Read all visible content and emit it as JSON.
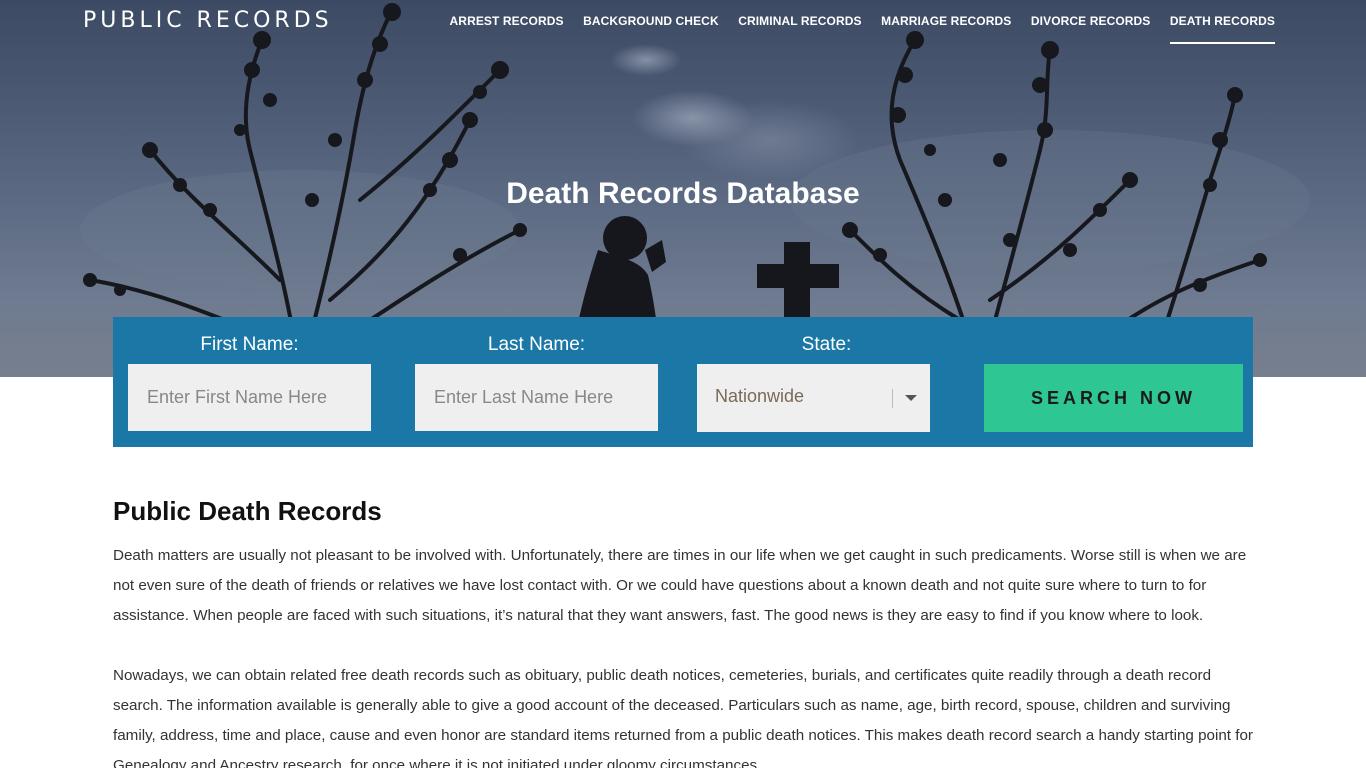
{
  "header": {
    "logo": "PUBLIC RECORDS",
    "nav": [
      {
        "label": "ARREST RECORDS",
        "active": false
      },
      {
        "label": "BACKGROUND CHECK",
        "active": false
      },
      {
        "label": "CRIMINAL RECORDS",
        "active": false
      },
      {
        "label": "MARRIAGE RECORDS",
        "active": false
      },
      {
        "label": "DIVORCE RECORDS",
        "active": false
      },
      {
        "label": "DEATH RECORDS",
        "active": true
      }
    ]
  },
  "hero": {
    "title": "Death Records Database"
  },
  "search": {
    "first_name_label": "First Name:",
    "first_name_placeholder": "Enter First Name Here",
    "last_name_label": "Last Name:",
    "last_name_placeholder": "Enter Last Name Here",
    "state_label": "State:",
    "state_value": "Nationwide",
    "button_label": "SEARCH NOW"
  },
  "content": {
    "heading": "Public Death Records",
    "paragraphs": [
      "Death matters are usually not pleasant to be involved with. Unfortunately, there are times in our life when we get caught in such predicaments. Worse still is when we are not even sure of the death of friends or relatives we have lost contact with. Or we could have questions about a known death and not quite sure where to turn to for assistance. When people are faced with such situations, it’s natural that they want answers, fast. The good news is they are easy to find if you know where to look.",
      "Nowadays, we can obtain related free death records such as obituary, public death notices, cemeteries, burials, and certificates quite readily through a death record search. The information available is generally able to give a good account of the deceased. Particulars such as name, age, birth record, spouse, children and surviving family, address, time and place, cause and even honor are standard items returned from a public death notices. This makes death record search a handy starting point for Genealogy and Ancestry research, for once where it is not initiated under gloomy circumstances."
    ]
  },
  "colors": {
    "form_background": "#1b77a6",
    "button_background": "#2ec793",
    "hero_sky": "#4a5872"
  }
}
